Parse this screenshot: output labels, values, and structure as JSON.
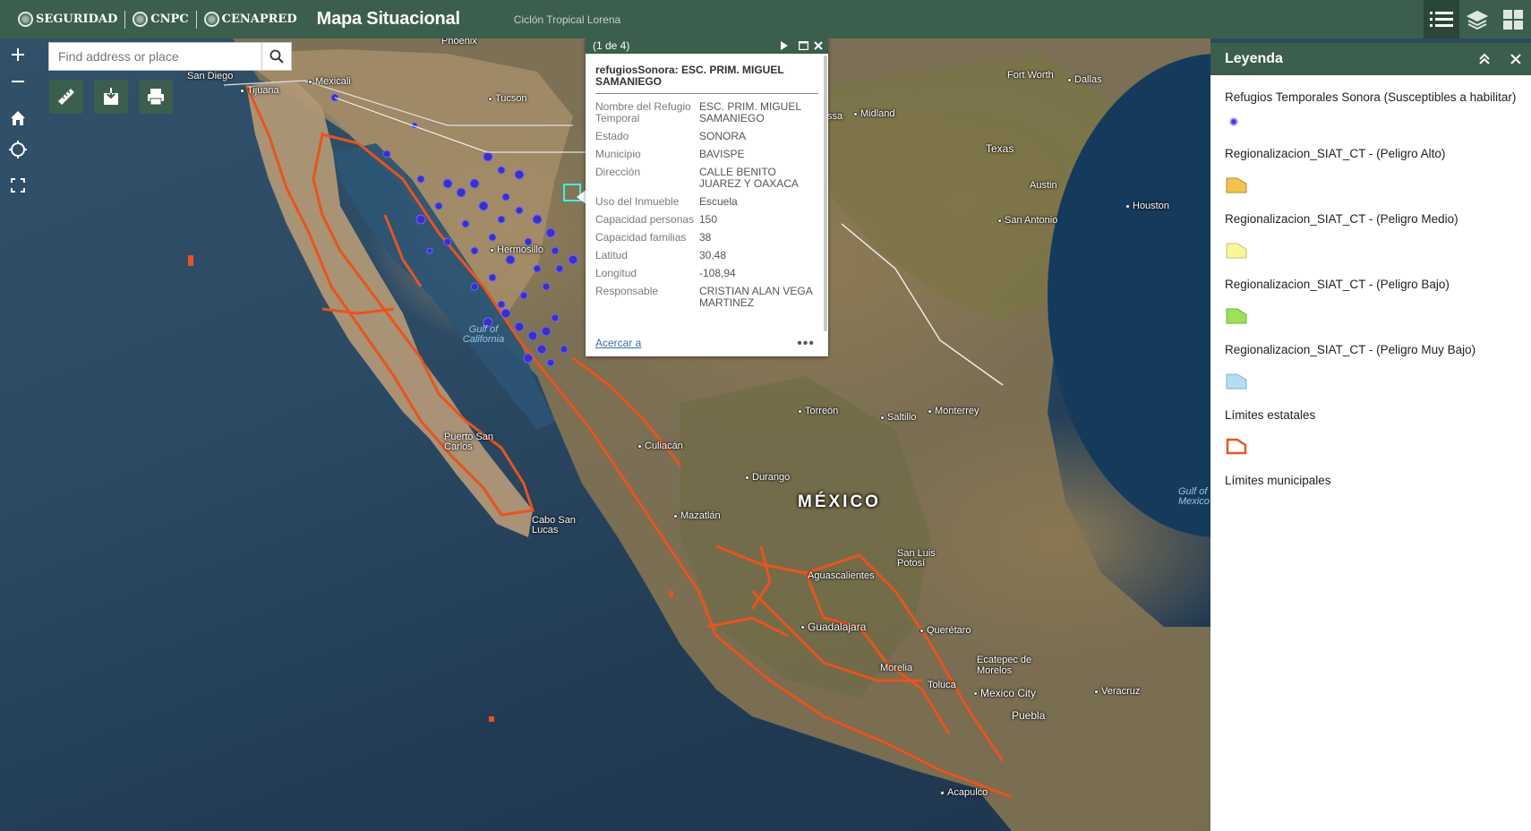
{
  "header": {
    "logos": [
      "SEGURIDAD",
      "CNPC",
      "CENAPRED"
    ],
    "title": "Mapa Situacional",
    "subtitle": "Ciclón Tropical Lorena"
  },
  "search": {
    "placeholder": "Find address or place"
  },
  "map": {
    "places": [
      {
        "id": "phoenix",
        "label": "Phoenix"
      },
      {
        "id": "san-diego",
        "label": "San Diego"
      },
      {
        "id": "tijuana",
        "label": "Tijuana"
      },
      {
        "id": "mexicali",
        "label": "Mexicali"
      },
      {
        "id": "tucson",
        "label": "Tucson"
      },
      {
        "id": "hermosillo",
        "label": "Hermosillo"
      },
      {
        "id": "gulf-california",
        "label": "Gulf of California"
      },
      {
        "id": "puerto-san-carlos",
        "label": "Puerto San Carlos"
      },
      {
        "id": "cabo-san-lucas",
        "label": "Cabo San Lucas"
      },
      {
        "id": "culiacan",
        "label": "Culiacán"
      },
      {
        "id": "mazatlan",
        "label": "Mazatlán"
      },
      {
        "id": "durango",
        "label": "Durango"
      },
      {
        "id": "torreon",
        "label": "Torreón"
      },
      {
        "id": "saltillo",
        "label": "Saltillo"
      },
      {
        "id": "monterrey",
        "label": "Monterrey"
      },
      {
        "id": "fort-worth",
        "label": "Fort Worth"
      },
      {
        "id": "dallas",
        "label": "Dallas"
      },
      {
        "id": "midland",
        "label": "Midland"
      },
      {
        "id": "ssa",
        "label": "ssa"
      },
      {
        "id": "texas",
        "label": "Texas"
      },
      {
        "id": "austin",
        "label": "Austin"
      },
      {
        "id": "houston",
        "label": "Houston"
      },
      {
        "id": "san-antonio",
        "label": "San Antonio"
      },
      {
        "id": "san-luis-potosi",
        "label": "San Luis Potosí"
      },
      {
        "id": "aguascalientes",
        "label": "Aguascalientes"
      },
      {
        "id": "guadalajara",
        "label": "Guadalajara"
      },
      {
        "id": "queretaro",
        "label": "Querétaro"
      },
      {
        "id": "ecatepec",
        "label": "Ecatepec de Morelos"
      },
      {
        "id": "morelia",
        "label": "Morelia"
      },
      {
        "id": "toluca",
        "label": "Toluca"
      },
      {
        "id": "mexico-city",
        "label": "Mexico City"
      },
      {
        "id": "puebla",
        "label": "Puebla"
      },
      {
        "id": "veracruz",
        "label": "Veracruz"
      },
      {
        "id": "acapulco",
        "label": "Acapulco"
      },
      {
        "id": "gulf-mexico",
        "label": "Gulf of Mexico"
      }
    ],
    "country": "MÉXICO"
  },
  "popup": {
    "counter": "(1 de 4)",
    "title": "refugiosSonora: ESC. PRIM. MIGUEL SAMANIEGO",
    "fields": [
      {
        "key": "Nombre del Refugio Temporal",
        "value": "ESC. PRIM. MIGUEL SAMANIEGO"
      },
      {
        "key": "Estado",
        "value": "SONORA"
      },
      {
        "key": "Municipio",
        "value": "BAVISPE"
      },
      {
        "key": "Dirección",
        "value": "CALLE BENITO JUAREZ Y OAXACA"
      },
      {
        "key": "Uso del Inmueble",
        "value": "Escuela"
      },
      {
        "key": "Capacidad personas",
        "value": "150"
      },
      {
        "key": "Capacidad familias",
        "value": "38"
      },
      {
        "key": "Latitud",
        "value": "30,48"
      },
      {
        "key": "Longitud",
        "value": "-108,94"
      },
      {
        "key": "Responsable",
        "value": "CRISTIAN ALAN VEGA MARTINEZ"
      }
    ],
    "zoom_link": "Acercar a",
    "more": "•••"
  },
  "legend": {
    "title": "Leyenda",
    "items": [
      {
        "label": "Refugios Temporales Sonora (Susceptibles a habilitar)",
        "symbol": "point",
        "color": "#4a3fc9"
      },
      {
        "label": "Regionalizacion_SIAT_CT - (Peligro Alto)",
        "symbol": "polygon",
        "color": "#f2c14e"
      },
      {
        "label": "Regionalizacion_SIAT_CT - (Peligro Medio)",
        "symbol": "polygon",
        "color": "#fbf59a"
      },
      {
        "label": "Regionalizacion_SIAT_CT - (Peligro Bajo)",
        "symbol": "polygon",
        "color": "#9fe05a"
      },
      {
        "label": "Regionalizacion_SIAT_CT - (Peligro Muy Bajo)",
        "symbol": "polygon",
        "color": "#b3dcf5"
      },
      {
        "label": "Límites estatales",
        "symbol": "outline",
        "color": "#e8541e"
      },
      {
        "label": "Límites municipales",
        "symbol": "none",
        "color": ""
      }
    ]
  },
  "colors": {
    "header": "#3c5e4c",
    "boundary": "#e8541e",
    "refuge": "#3a30c4"
  }
}
